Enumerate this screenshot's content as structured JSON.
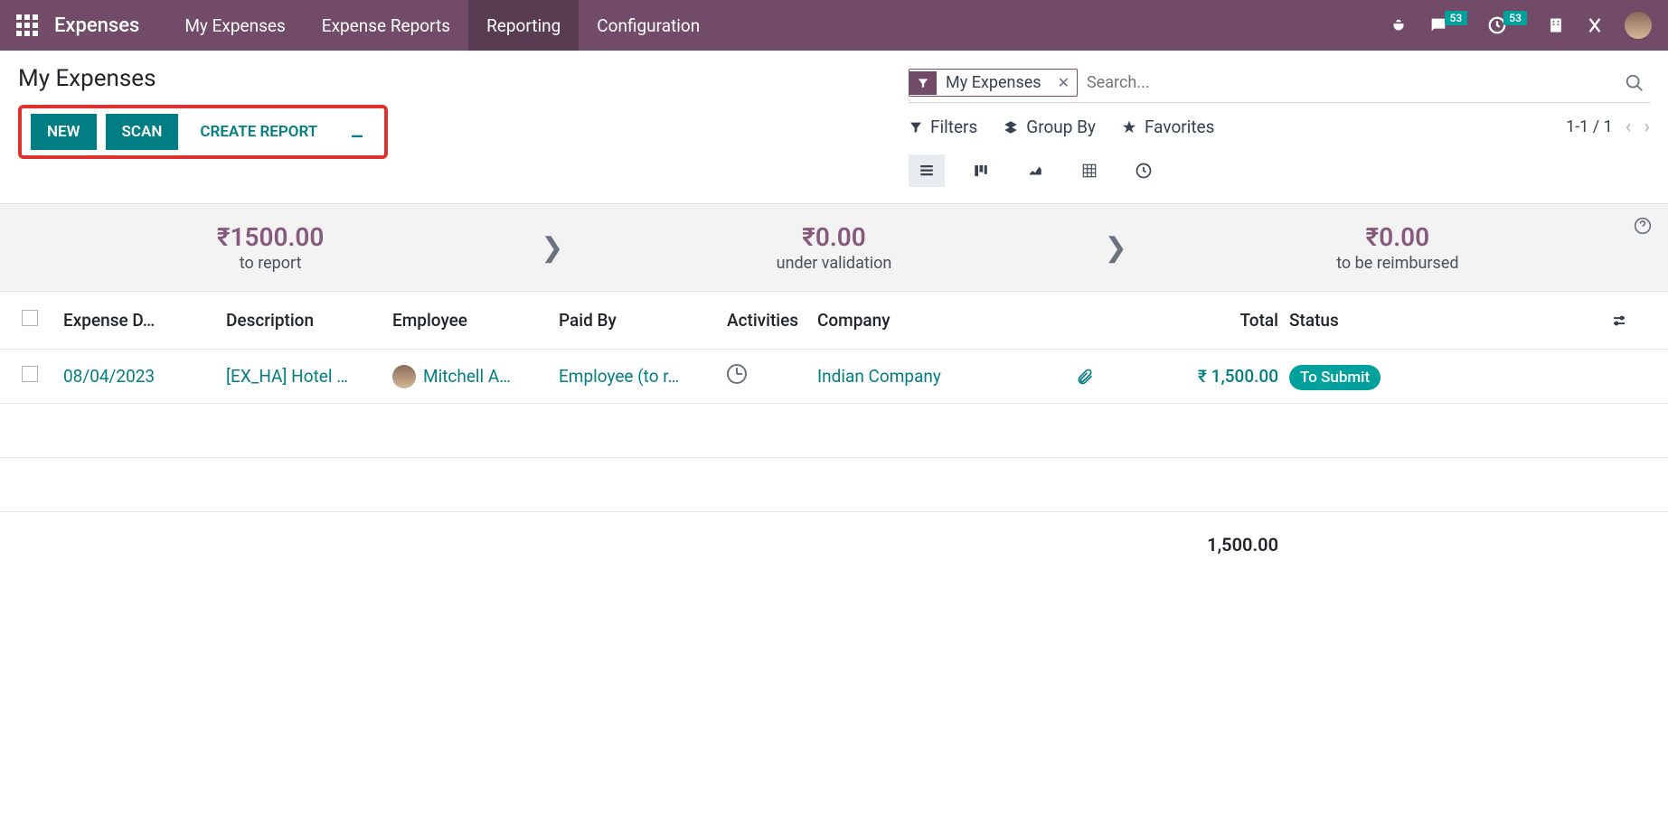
{
  "app": {
    "title": "Expenses"
  },
  "nav": {
    "my_expenses": "My Expenses",
    "expense_reports": "Expense Reports",
    "reporting": "Reporting",
    "configuration": "Configuration"
  },
  "badges": {
    "chat": "53",
    "clock": "53"
  },
  "page_title": "My Expenses",
  "buttons": {
    "new": "NEW",
    "scan": "SCAN",
    "create_report": "CREATE REPORT"
  },
  "search": {
    "chip_label": "My Expenses",
    "placeholder": "Search..."
  },
  "options": {
    "filters": "Filters",
    "group_by": "Group By",
    "favorites": "Favorites"
  },
  "pager": "1-1 / 1",
  "summary": {
    "to_report": {
      "amount": "₹1500.00",
      "label": "to report"
    },
    "under_validation": {
      "amount": "₹0.00",
      "label": "under validation"
    },
    "to_be_reimbursed": {
      "amount": "₹0.00",
      "label": "to be reimbursed"
    }
  },
  "columns": {
    "date": "Expense D…",
    "description": "Description",
    "employee": "Employee",
    "paid_by": "Paid By",
    "activities": "Activities",
    "company": "Company",
    "total": "Total",
    "status": "Status"
  },
  "rows": {
    "0": {
      "date": "08/04/2023",
      "description": "[EX_HA] Hotel …",
      "employee": "Mitchell A…",
      "paid_by": "Employee (to r…",
      "company": "Indian Company",
      "total": "₹ 1,500.00",
      "status": "To Submit"
    }
  },
  "footer": {
    "total": "1,500.00"
  }
}
